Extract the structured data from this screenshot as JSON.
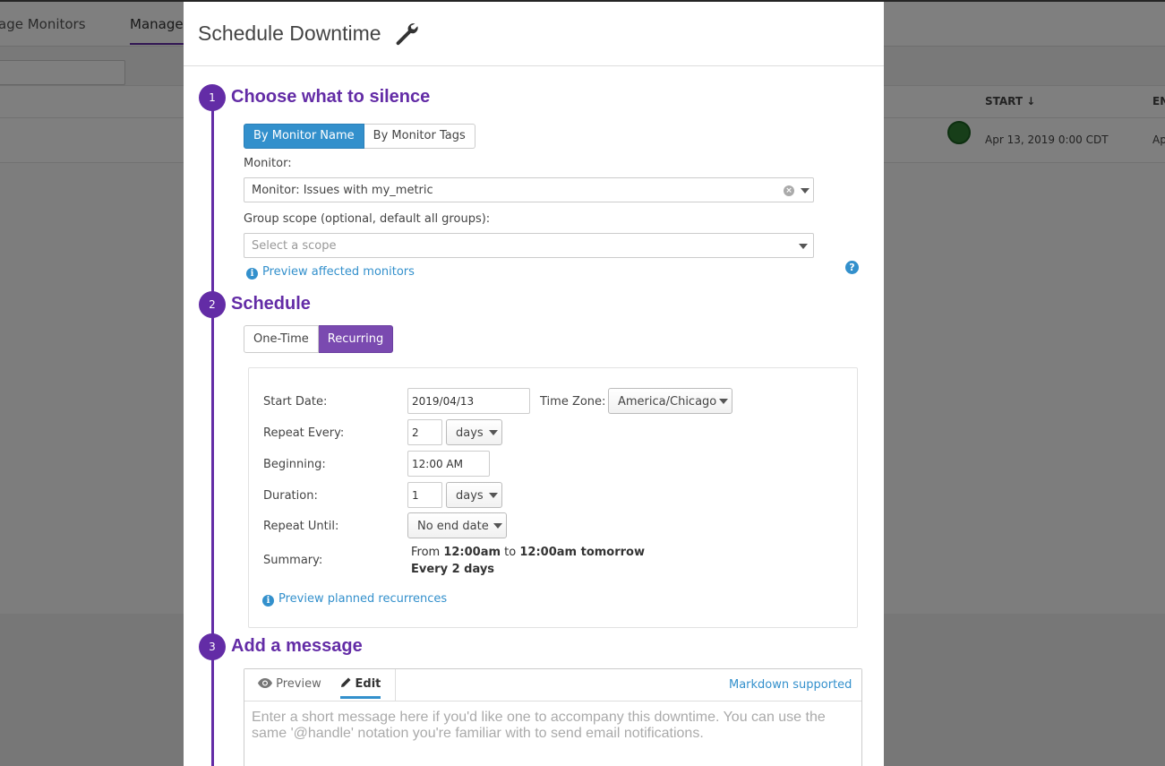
{
  "background": {
    "tabs": [
      "age Monitors",
      "Manage"
    ],
    "table_headers": {
      "start": "START ↓",
      "end": "EN"
    },
    "row": {
      "start": "Apr 13, 2019 0:00 CDT",
      "end": "Ap"
    }
  },
  "modal": {
    "title": "Schedule Downtime",
    "title_icon": "wrench-icon"
  },
  "step1": {
    "number": "1",
    "title": "Choose what to silence",
    "toggle": {
      "by_name": "By Monitor Name",
      "by_tags": "By Monitor Tags",
      "selected": "By Monitor Name"
    },
    "monitor_label": "Monitor:",
    "monitor_value": "Monitor: Issues with my_metric",
    "group_scope_label": "Group scope (optional, default all groups):",
    "group_scope_placeholder": "Select a scope",
    "preview_link": "Preview affected monitors"
  },
  "step2": {
    "number": "2",
    "title": "Schedule",
    "toggle": {
      "one_time": "One-Time",
      "recurring": "Recurring",
      "selected": "Recurring"
    },
    "start_date_label": "Start Date:",
    "start_date_value": "2019/04/13",
    "time_zone_label": "Time Zone:",
    "time_zone_value": "America/Chicago",
    "repeat_every_label": "Repeat Every:",
    "repeat_every_value": "2",
    "repeat_every_unit": "days",
    "beginning_label": "Beginning:",
    "beginning_value": "12:00  AM",
    "duration_label": "Duration:",
    "duration_value": "1",
    "duration_unit": "days",
    "repeat_until_label": "Repeat Until:",
    "repeat_until_value": "No end date",
    "summary_label": "Summary:",
    "summary": {
      "from": "From ",
      "start": "12:00am",
      "to": " to ",
      "end": "12:00am tomorrow",
      "every": "Every 2 days"
    },
    "preview_link": "Preview planned recurrences"
  },
  "step3": {
    "number": "3",
    "title": "Add a message",
    "tab_preview": "Preview",
    "tab_edit": "Edit",
    "markdown_link": "Markdown supported",
    "placeholder": "Enter a short message here if you'd like one to accompany this downtime. You can use the same '@handle' notation you're familiar with to send email notifications."
  },
  "colors": {
    "accent_purple": "#632ca6",
    "link_blue": "#3390cc"
  }
}
